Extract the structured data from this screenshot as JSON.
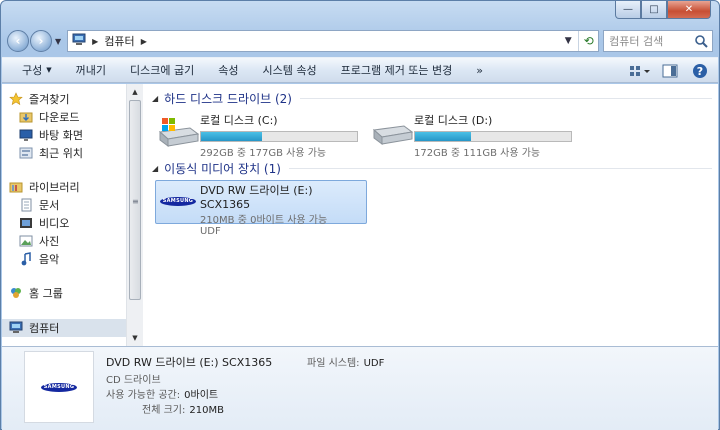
{
  "window": {
    "caption": {
      "minimize": "—",
      "maximize": "□",
      "close": "✕"
    }
  },
  "address": {
    "segments": [
      "컴퓨터"
    ],
    "search_placeholder": "컴퓨터 검색"
  },
  "commands": [
    {
      "label": "구성",
      "dropdown": true
    },
    {
      "label": "꺼내기",
      "dropdown": false
    },
    {
      "label": "디스크에 굽기",
      "dropdown": false
    },
    {
      "label": "속성",
      "dropdown": false
    },
    {
      "label": "시스템 속성",
      "dropdown": false
    },
    {
      "label": "프로그램 제거 또는 변경",
      "dropdown": false
    },
    {
      "label": "»",
      "dropdown": false
    }
  ],
  "sidebar": {
    "favorites": {
      "label": "즐겨찾기",
      "items": [
        "다운로드",
        "바탕 화면",
        "최근 위치"
      ]
    },
    "libraries": {
      "label": "라이브러리",
      "items": [
        "문서",
        "비디오",
        "사진",
        "음악"
      ]
    },
    "homegroup": "홈 그룹",
    "computer": "컴퓨터"
  },
  "groups": {
    "hdd": {
      "title": "하드 디스크 드라이브 (2)"
    },
    "removable": {
      "title": "이동식 미디어 장치 (1)"
    }
  },
  "drives": [
    {
      "name": "로컬 디스크 (C:)",
      "usage": "292GB 중 177GB 사용 가능",
      "used_fraction": 0.39
    },
    {
      "name": "로컬 디스크 (D:)",
      "usage": "172GB 중 111GB 사용 가능",
      "used_fraction": 0.36
    }
  ],
  "dvd": {
    "name": "DVD RW 드라이브 (E:) SCX1365",
    "usage": "210MB 중 0바이트 사용 가능",
    "fs": "UDF",
    "logo": "SAMSUNG"
  },
  "details": {
    "name": "DVD RW 드라이브 (E:) SCX1365",
    "type": "CD 드라이브",
    "free_label": "사용 가능한 공간:",
    "free_value": "0바이트",
    "total_label": "전체 크기:",
    "total_value": "210MB",
    "fs_label": "파일 시스템:",
    "fs_value": "UDF"
  },
  "colors": {
    "accent": "#1e3287",
    "bar_fill": "#2696c7",
    "selection": "#c4dcf7"
  }
}
